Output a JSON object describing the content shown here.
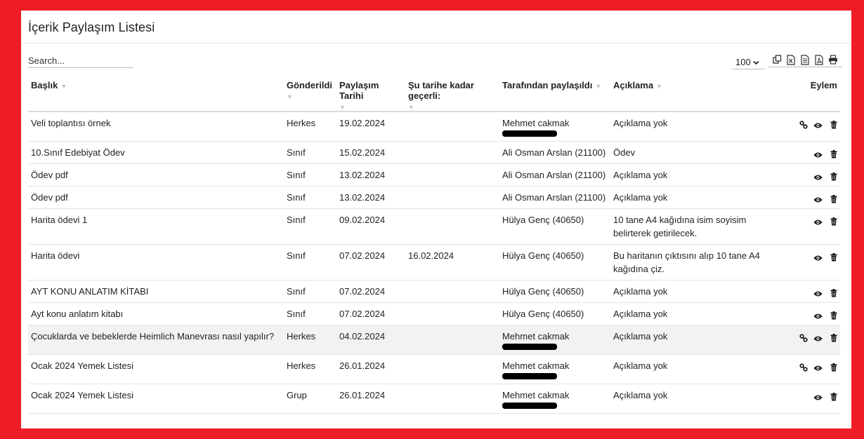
{
  "page": {
    "title": "İçerik Paylaşım Listesi",
    "search_placeholder": "Search...",
    "page_size": "100"
  },
  "colors": {
    "frame": "#ee1c25",
    "panel": "#ffffff",
    "row_highlight": "#f2f2f2"
  },
  "toolbar_icons": [
    "copy-icon",
    "excel-icon",
    "csv-icon",
    "pdf-icon",
    "print-icon"
  ],
  "columns": {
    "baslik": "Başlık",
    "gonderildi": "Gönderildi",
    "paylasim_tarihi": "Paylaşım Tarihi",
    "gecerli": "Şu tarihe kadar geçerli:",
    "paylasan": "Tarafından paylaşıldı",
    "aciklama": "Açıklama",
    "eylem": "Eylem"
  },
  "rows": [
    {
      "title": "Veli toplantısı örnek",
      "sent": "Herkes",
      "date": "19.02.2024",
      "valid": "",
      "by": "Mehmet cakmak",
      "desc": "Açıklama yok",
      "redacted": true,
      "link": true,
      "highlight": false
    },
    {
      "title": "10.Sınıf Edebiyat Ödev",
      "sent": "Sınıf",
      "date": "15.02.2024",
      "valid": "",
      "by": "Ali Osman Arslan (21100)",
      "desc": "Ödev",
      "redacted": false,
      "link": false,
      "highlight": false
    },
    {
      "title": "Ödev pdf",
      "sent": "Sınıf",
      "date": "13.02.2024",
      "valid": "",
      "by": "Ali Osman Arslan (21100)",
      "desc": "Açıklama yok",
      "redacted": false,
      "link": false,
      "highlight": false
    },
    {
      "title": "Ödev pdf",
      "sent": "Sınıf",
      "date": "13.02.2024",
      "valid": "",
      "by": "Ali Osman Arslan (21100)",
      "desc": "Açıklama yok",
      "redacted": false,
      "link": false,
      "highlight": false
    },
    {
      "title": "Harita ödevi 1",
      "sent": "Sınıf",
      "date": "09.02.2024",
      "valid": "",
      "by": "Hülya Genç (40650)",
      "desc": "10 tane A4 kağıdına isim soyisim belirterek getirilecek.",
      "redacted": false,
      "link": false,
      "highlight": false
    },
    {
      "title": "Harita ödevi",
      "sent": "Sınıf",
      "date": "07.02.2024",
      "valid": "16.02.2024",
      "by": "Hülya Genç (40650)",
      "desc": "Bu haritanın çıktısını alıp 10 tane A4 kağıdına çiz.",
      "redacted": false,
      "link": false,
      "highlight": false
    },
    {
      "title": "AYT KONU ANLATIM KİTABI",
      "sent": "Sınıf",
      "date": "07.02.2024",
      "valid": "",
      "by": "Hülya Genç (40650)",
      "desc": "Açıklama yok",
      "redacted": false,
      "link": false,
      "highlight": false
    },
    {
      "title": "Ayt konu anlatım kitabı",
      "sent": "Sınıf",
      "date": "07.02.2024",
      "valid": "",
      "by": "Hülya Genç (40650)",
      "desc": "Açıklama yok",
      "redacted": false,
      "link": false,
      "highlight": false
    },
    {
      "title": "Çocuklarda ve bebeklerde Heimlich Manevrası nasıl yapılır?",
      "sent": "Herkes",
      "date": "04.02.2024",
      "valid": "",
      "by": "Mehmet cakmak",
      "desc": "Açıklama yok",
      "redacted": true,
      "link": true,
      "highlight": true
    },
    {
      "title": "Ocak 2024 Yemek Listesi",
      "sent": "Herkes",
      "date": "26.01.2024",
      "valid": "",
      "by": "Mehmet cakmak",
      "desc": "Açıklama yok",
      "redacted": true,
      "link": true,
      "highlight": false
    },
    {
      "title": "Ocak 2024 Yemek Listesi",
      "sent": "Grup",
      "date": "26.01.2024",
      "valid": "",
      "by": "Mehmet cakmak",
      "desc": "Açıklama yok",
      "redacted": true,
      "link": false,
      "highlight": false
    }
  ]
}
